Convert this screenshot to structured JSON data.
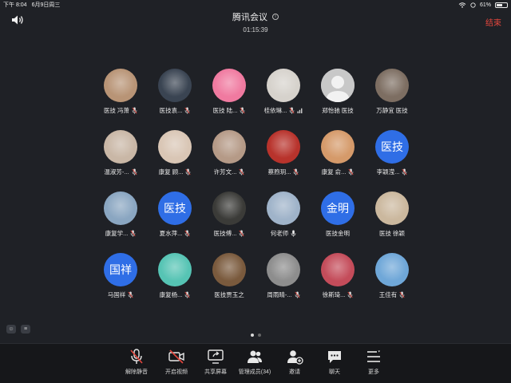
{
  "status_bar": {
    "time": "下午 8:04",
    "date": "6月9日周三",
    "battery": "61%",
    "battery_level": 0.61
  },
  "header": {
    "title": "腾讯会议",
    "timer": "01:15:39",
    "end_label": "结束"
  },
  "participants": [
    {
      "name": "医技 冯萧",
      "avatar": "photo-child",
      "avatar_color": "#b89476",
      "mic": "muted"
    },
    {
      "name": "医技袁...",
      "avatar": "photo-dark",
      "avatar_color": "#3a4452",
      "mic": "muted"
    },
    {
      "name": "医技 陆...",
      "avatar": "photo-pink",
      "avatar_color": "#f07aa0",
      "mic": "muted"
    },
    {
      "name": "桂依琳...",
      "avatar": "photo-girl",
      "avatar_color": "#d6d2cc",
      "mic": "muted",
      "signal": true
    },
    {
      "name": "郑怡驰 医技",
      "avatar": "default-person",
      "avatar_color": "#c8c8c8",
      "mic": "none"
    },
    {
      "name": "万静宜 医技",
      "avatar": "photo-street",
      "avatar_color": "#7d6e62",
      "mic": "none"
    },
    {
      "name": "温淑芳-...",
      "avatar": "photo-baby",
      "avatar_color": "#c9b7a6",
      "mic": "muted"
    },
    {
      "name": "康复 顾...",
      "avatar": "photo-girl2",
      "avatar_color": "#d9c6b5",
      "mic": "muted"
    },
    {
      "name": "许芳文...",
      "avatar": "photo-kid",
      "avatar_color": "#b59a87",
      "mic": "muted"
    },
    {
      "name": "蔡煦玥...",
      "avatar": "photo-red",
      "avatar_color": "#b8332c",
      "mic": "muted"
    },
    {
      "name": "康复 俞...",
      "avatar": "photo-cat",
      "avatar_color": "#d59a6a",
      "mic": "muted"
    },
    {
      "name": "李颖滢...",
      "avatar": "text",
      "avatar_text": "医技",
      "avatar_color": "#2f6ee6",
      "mic": "muted"
    },
    {
      "name": "康复学...",
      "avatar": "photo-blue",
      "avatar_color": "#8aa6c1",
      "mic": "muted"
    },
    {
      "name": "夏水萍...",
      "avatar": "text",
      "avatar_text": "医技",
      "avatar_color": "#2f6ee6",
      "mic": "muted"
    },
    {
      "name": "医技傅...",
      "avatar": "photo-dog",
      "avatar_color": "#3b3b38",
      "mic": "muted"
    },
    {
      "name": "何老师",
      "avatar": "photo-dance",
      "avatar_color": "#9fb3c9",
      "mic": "on"
    },
    {
      "name": "医技金明",
      "avatar": "text",
      "avatar_text": "金明",
      "avatar_color": "#2f6ee6",
      "mic": "none"
    },
    {
      "name": "医技 徐颖",
      "avatar": "photo-dog2",
      "avatar_color": "#cbb89e",
      "mic": "none"
    },
    {
      "name": "马国祥",
      "avatar": "text",
      "avatar_text": "国祥",
      "avatar_color": "#2f6ee6",
      "mic": "muted"
    },
    {
      "name": "康复杨...",
      "avatar": "photo-cup",
      "avatar_color": "#56c4b4",
      "mic": "muted"
    },
    {
      "name": "医技贾玉之",
      "avatar": "photo-dog3",
      "avatar_color": "#7a5a3d",
      "mic": "none"
    },
    {
      "name": "周雨晴-...",
      "avatar": "photo-cat2",
      "avatar_color": "#8d8d8d",
      "mic": "muted"
    },
    {
      "name": "徐斯琦...",
      "avatar": "photo-anime",
      "avatar_color": "#c44c5a",
      "mic": "muted"
    },
    {
      "name": "王佳有",
      "avatar": "photo-sky",
      "avatar_color": "#6fa7d8",
      "mic": "muted"
    }
  ],
  "toolbar": {
    "unmute": "解除静音",
    "video": "开启视频",
    "share": "共享屏幕",
    "members": "管理成员(34)",
    "invite": "邀请",
    "chat": "聊天",
    "more": "更多"
  },
  "colors": {
    "end": "#e5463d",
    "accent": "#2f6ee6",
    "mute": "#e5463d"
  }
}
